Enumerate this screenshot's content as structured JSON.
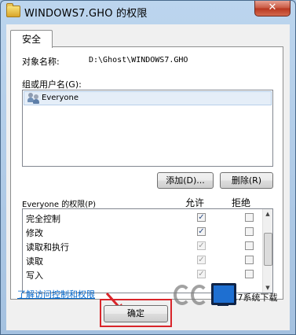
{
  "window": {
    "title": "WINDOWS7.GHO 的权限",
    "close_glyph": "✕"
  },
  "tab": {
    "label": "安全"
  },
  "object": {
    "label": "对象名称:",
    "value": "D:\\Ghost\\WINDOWS7.GHO"
  },
  "groups": {
    "label": "组或用户名(G):",
    "items": [
      {
        "name": "Everyone",
        "icon": "users-icon"
      }
    ]
  },
  "buttons": {
    "add": "添加(D)...",
    "remove": "删除(R)",
    "ok": "确定"
  },
  "permissions": {
    "header": "Everyone 的权限(P)",
    "allow_label": "允许",
    "deny_label": "拒绝",
    "rows": [
      {
        "name": "完全控制",
        "allow": true,
        "deny": false
      },
      {
        "name": "修改",
        "allow": true,
        "deny": false
      },
      {
        "name": "读取和执行",
        "allow": true,
        "deny": false
      },
      {
        "name": "读取",
        "allow": true,
        "deny": false
      },
      {
        "name": "写入",
        "allow": true,
        "deny": false
      }
    ]
  },
  "link": {
    "text": "了解访问控制和权限"
  },
  "watermark": {
    "text": ".7系统下载"
  },
  "colors": {
    "accent_red": "#d9252a",
    "link_blue": "#0066cc"
  }
}
